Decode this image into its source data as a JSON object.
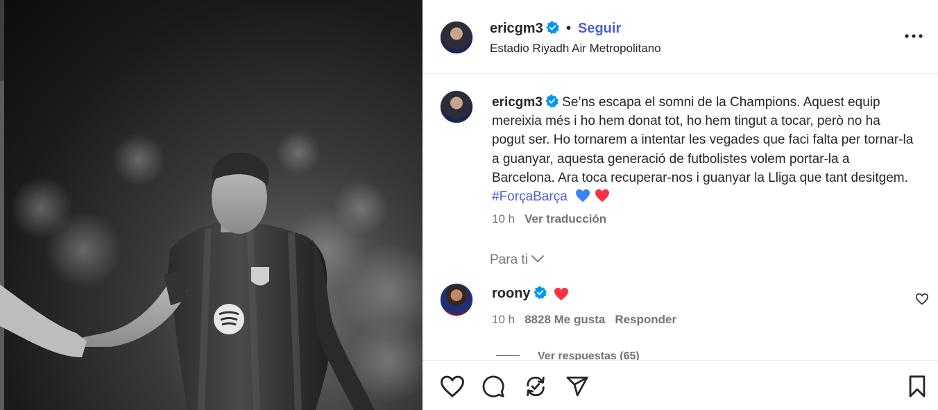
{
  "post": {
    "username": "ericgm3",
    "follow_label": "Seguir",
    "separator": "•",
    "location": "Estadio Riyadh Air Metropolitano",
    "caption_username": "ericgm3",
    "caption_text": "Se’ns escapa el somni de la Champions. Aquest equip mereixia més i ho hem donat tot, ho hem tingut a tocar, però no ha pogut ser. Ho tornarem a intentar les vegades que faci falta per tornar-la a guanyar, aquesta generació de futbolistes volem portar-la a Barcelona. Ara toca recuperar-nos i guanyar la Lliga que tant desitgem.",
    "hashtag": "#ForçaBarça",
    "caption_emojis": [
      "blue-heart-icon",
      "red-heart-icon"
    ],
    "time": "10 h",
    "translate_label": "Ver traducción"
  },
  "comments_filter": {
    "label": "Para ti"
  },
  "comment": {
    "username": "roony",
    "time": "10 h",
    "likes_label": "8828 Me gusta",
    "reply_label": "Responder",
    "view_replies_label": "Ver respuestas (65)"
  },
  "icons": {
    "more": "more-options-icon",
    "verified": "verified-badge-icon",
    "like": "heart-outline-icon",
    "comment": "comment-bubble-icon",
    "repost": "repost-icon",
    "share": "paper-plane-icon",
    "save": "bookmark-icon",
    "chevron": "chevron-down-icon"
  },
  "colors": {
    "link_blue": "#4c5fd5",
    "verified_blue": "#0095f6",
    "secondary_text": "#737373",
    "heart_red": "#ff3040",
    "heart_blue": "#3b82f6"
  }
}
